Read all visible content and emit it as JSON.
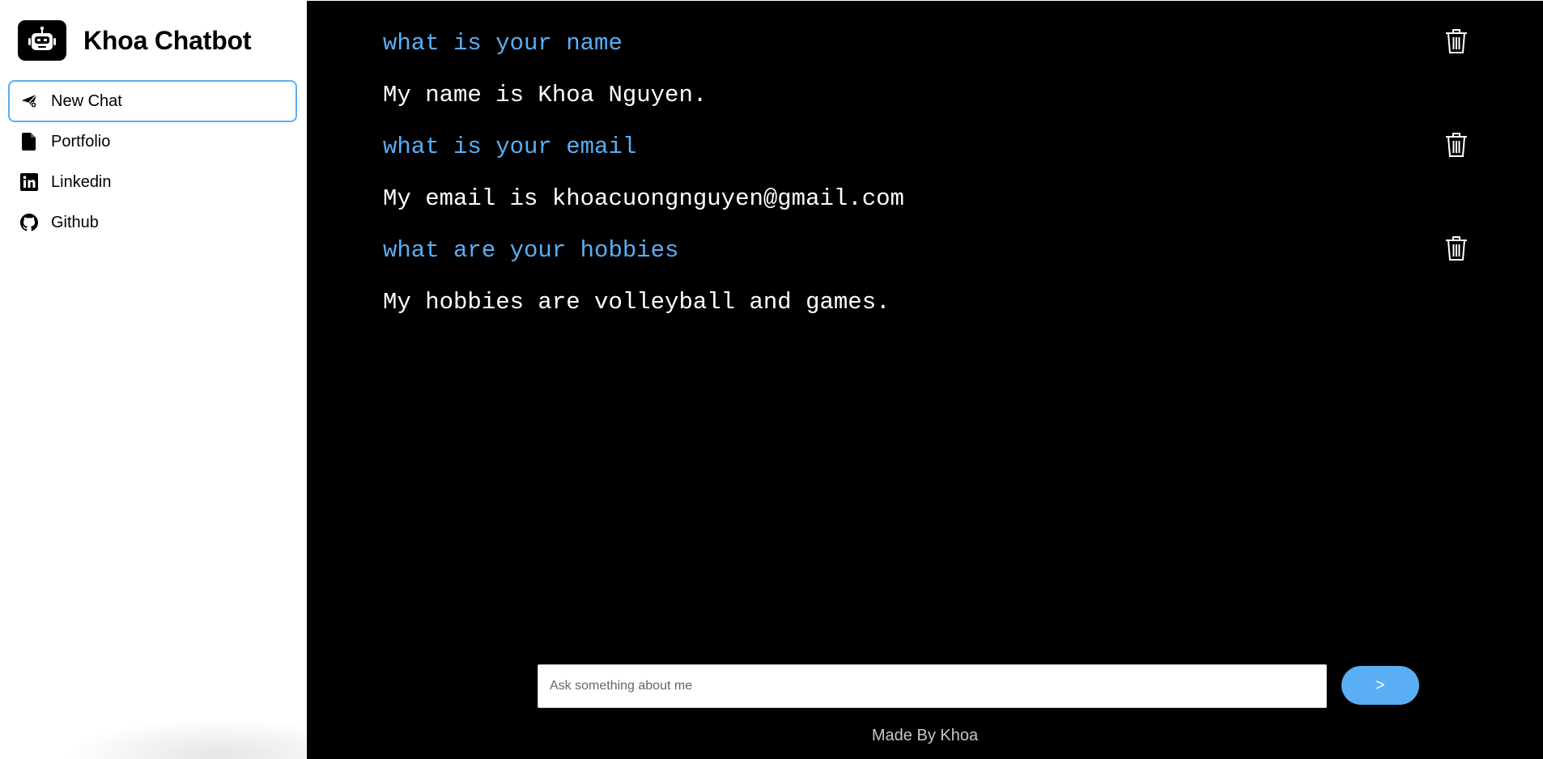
{
  "app": {
    "title": "Khoa Chatbot"
  },
  "sidebar": {
    "items": [
      {
        "label": "New Chat",
        "icon": "paper-plane-icon",
        "active": true
      },
      {
        "label": "Portfolio",
        "icon": "file-icon"
      },
      {
        "label": "Linkedin",
        "icon": "linkedin-icon"
      },
      {
        "label": "Github",
        "icon": "github-icon"
      }
    ]
  },
  "chat": {
    "messages": [
      {
        "question": "what is your name",
        "answer": "My name is Khoa Nguyen."
      },
      {
        "question": "what is your email",
        "answer": "My email is khoacuongnguyen@gmail.com"
      },
      {
        "question": "what are your hobbies",
        "answer": "My hobbies are volleyball and games."
      }
    ]
  },
  "composer": {
    "placeholder": "Ask something about me",
    "value": "",
    "send_label": ">"
  },
  "footer": {
    "text": "Made By Khoa"
  },
  "colors": {
    "accent": "#5aaef4",
    "main_bg": "#000000",
    "sidebar_bg": "#ffffff"
  }
}
